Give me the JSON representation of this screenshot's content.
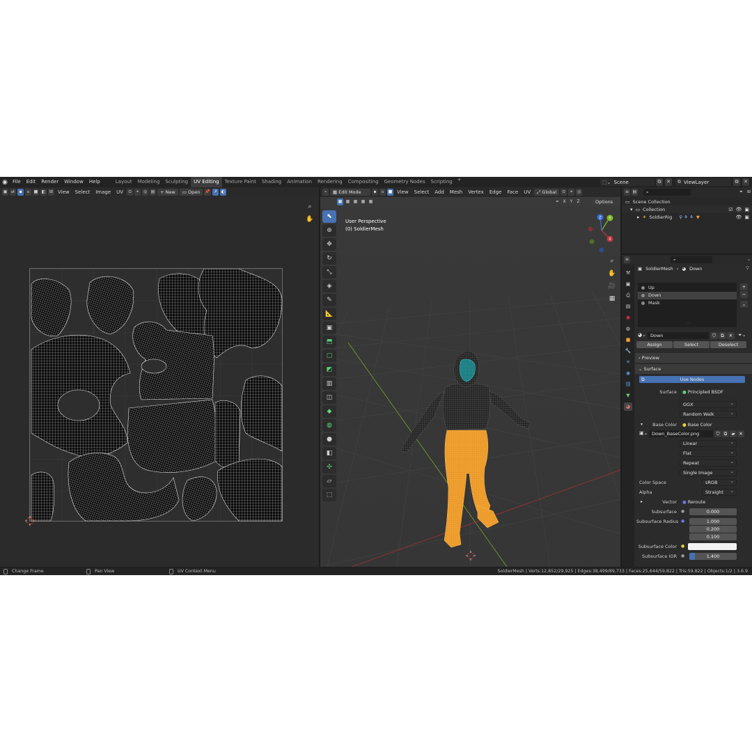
{
  "menu": [
    "File",
    "Edit",
    "Render",
    "Window",
    "Help"
  ],
  "workspaces": [
    "Layout",
    "Modeling",
    "Sculpting",
    "UV Editing",
    "Texture Paint",
    "Shading",
    "Animation",
    "Rendering",
    "Compositing",
    "Geometry Nodes",
    "Scripting"
  ],
  "active_workspace": "UV Editing",
  "add_workspace": "+",
  "scene_name": "Scene",
  "view_layer": "ViewLayer",
  "uv_header": {
    "menus": [
      "View",
      "Select",
      "Image",
      "UV"
    ],
    "new_label": "New",
    "open_label": "Open"
  },
  "viewport_header": {
    "mode": "Edit Mode",
    "menus": [
      "View",
      "Select",
      "Add",
      "Mesh",
      "Vertex",
      "Edge",
      "Face",
      "UV"
    ],
    "orientation": "Global",
    "options": "Options",
    "axes": [
      "X",
      "Y",
      "Z"
    ]
  },
  "viewport_overlay": {
    "view_name": "User Perspective",
    "object_name": "(0) SoldierMesh"
  },
  "gizmo": {
    "x": "X",
    "y": "Y",
    "z": "Z"
  },
  "outliner": {
    "search_placeholder": "",
    "rows": [
      "Scene Collection",
      "Collection",
      "SoldierRig"
    ]
  },
  "properties": {
    "object": "SoldierMesh",
    "material": "Down",
    "slots": [
      "Up",
      "Down",
      "Mask"
    ],
    "material_field": "Down",
    "assign": "Assign",
    "select": "Select",
    "deselect": "Deselect",
    "preview": "Preview",
    "surface_panel": "Surface",
    "use_nodes": "Use Nodes",
    "surface_label": "Surface",
    "surface_value": "Principled BSDF",
    "distribution": "GGX",
    "subsurface_method": "Random Walk",
    "base_color_label": "Base Color",
    "base_color_value": "Base Color",
    "image_name": "Down_BaseColor.png",
    "interpolation": "Linear",
    "projection": "Flat",
    "extension": "Repeat",
    "source": "Single Image",
    "color_space_label": "Color Space",
    "color_space": "sRGB",
    "alpha_label": "Alpha",
    "alpha": "Straight",
    "vector_label": "Vector",
    "vector_value": "Reroute",
    "subsurface_label": "Subsurface",
    "subsurface_value": "0.000",
    "subsurface_radius_label": "Subsurface Radius",
    "radius": [
      "1.000",
      "0.200",
      "0.100"
    ],
    "subsurface_color_label": "Subsurface Color",
    "subsurface_ior_label": "Subsurface IOR",
    "subsurface_ior": "1.400"
  },
  "status": {
    "left": [
      "Change Frame",
      "Pan View",
      "UV Context Menu"
    ],
    "stats": "SoldierMesh | Verts:12,852/29,925 | Edges:38,499/89,733 | Faces:25,644/59,822 | Tris:59,822 | Objects:1/2 | 3.6.9"
  },
  "colors": {
    "accent": "#4772b3",
    "selection_orange": "#f0a030",
    "mask_cyan": "#2fc9c9",
    "x_axis": "#c0393f",
    "y_axis": "#7fb92a",
    "z_axis": "#3c6fd1"
  }
}
